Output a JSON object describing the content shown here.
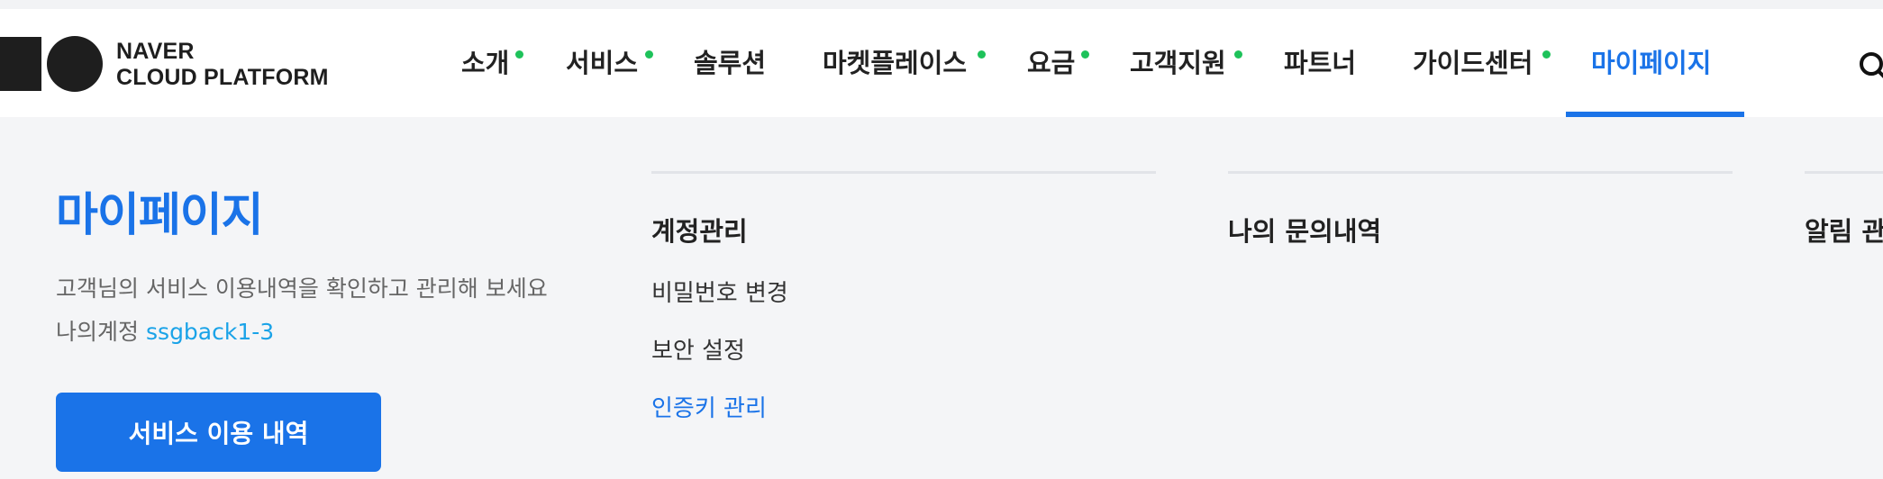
{
  "logo": {
    "line1": "NAVER",
    "line2": "CLOUD PLATFORM"
  },
  "nav": [
    {
      "label": "소개",
      "dot": true
    },
    {
      "label": "서비스",
      "dot": true
    },
    {
      "label": "솔루션",
      "dot": false
    },
    {
      "label": "마켓플레이스",
      "dot": true
    },
    {
      "label": "요금",
      "dot": true
    },
    {
      "label": "고객지원",
      "dot": true
    },
    {
      "label": "파트너",
      "dot": false
    },
    {
      "label": "가이드센터",
      "dot": true
    },
    {
      "label": "마이페이지",
      "dot": false,
      "active": true
    }
  ],
  "icons": {
    "search": "search-icon"
  },
  "colors": {
    "accent": "#1a73e8",
    "dot": "#1ec25a",
    "account_id": "#1aa3e8"
  },
  "panel": {
    "title": "마이페이지",
    "description": "고객님의 서비스 이용내역을 확인하고 관리해 보세요",
    "account_label": "나의계정",
    "account_id": "ssgback1-3",
    "cta_label": "서비스 이용 내역"
  },
  "columns": [
    {
      "title": "계정관리",
      "links": [
        {
          "label": "비밀번호 변경"
        },
        {
          "label": "보안 설정"
        },
        {
          "label": "인증키 관리",
          "active": true
        }
      ]
    },
    {
      "title": "나의 문의내역",
      "links": []
    },
    {
      "title": "알림 관리",
      "links": []
    }
  ]
}
